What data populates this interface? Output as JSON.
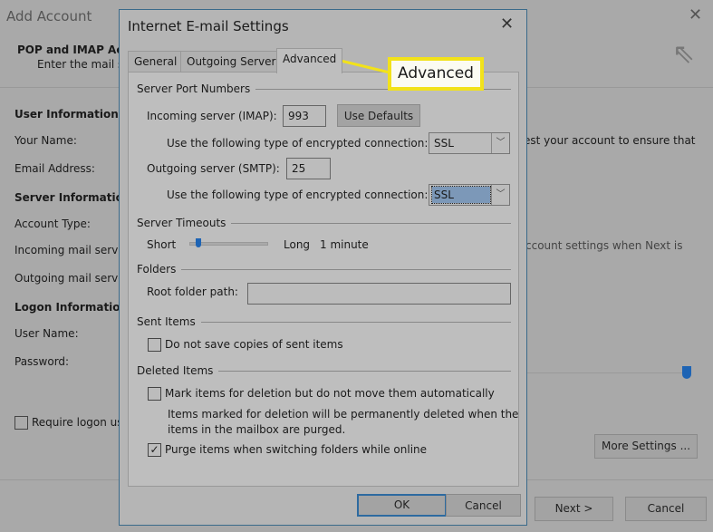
{
  "background_window": {
    "title": "Add Account",
    "header_title": "POP and IMAP Ac",
    "header_subtitle": "Enter the mail s",
    "labels": {
      "user_information": "User Information",
      "your_name": "Your Name:",
      "email_address": "Email Address:",
      "server_information": "Server Information",
      "account_type": "Account Type:",
      "incoming_mail_server": "Incoming mail serve",
      "outgoing_mail_server": "Outgoing mail serve",
      "logon_information": "Logon Information",
      "user_name": "User Name:",
      "password": "Password:",
      "require_logon": "Require logon us",
      "test_text": "est your account to ensure that",
      "account_settings_text": "ccount settings when Next is"
    },
    "buttons": {
      "more_settings": "More Settings ...",
      "next": "Next >",
      "cancel": "Cancel"
    }
  },
  "dialog": {
    "title": "Internet E-mail Settings",
    "tabs": [
      {
        "label": "General"
      },
      {
        "label": "Outgoing Server"
      },
      {
        "label": "Advanced",
        "active": true
      }
    ],
    "callout": "Advanced",
    "server_port_numbers": {
      "heading": "Server Port Numbers",
      "incoming_label": "Incoming server (IMAP):",
      "incoming_value": "993",
      "use_defaults": "Use Defaults",
      "encryption_label": "Use the following type of encrypted connection:",
      "incoming_encryption": "SSL",
      "outgoing_label": "Outgoing server (SMTP):",
      "outgoing_value": "25",
      "outgoing_encryption": "SSL"
    },
    "server_timeouts": {
      "heading": "Server Timeouts",
      "short": "Short",
      "long": "Long",
      "value": "1 minute",
      "slider_fraction": 0.1
    },
    "folders": {
      "heading": "Folders",
      "root_label": "Root folder path:",
      "root_value": ""
    },
    "sent_items": {
      "heading": "Sent Items",
      "do_not_save": "Do not save copies of sent items",
      "do_not_save_checked": false
    },
    "deleted_items": {
      "heading": "Deleted Items",
      "mark_items": "Mark items for deletion but do not move them automatically",
      "mark_items_checked": false,
      "note_line1": "Items marked for deletion will be permanently deleted when the",
      "note_line2": "items in the mailbox are purged.",
      "purge": "Purge items when switching folders while online",
      "purge_checked": true
    },
    "ok": "OK",
    "cancel": "Cancel"
  },
  "colors": {
    "callout_border": "#f2e21a",
    "accent": "#1e64b4"
  }
}
